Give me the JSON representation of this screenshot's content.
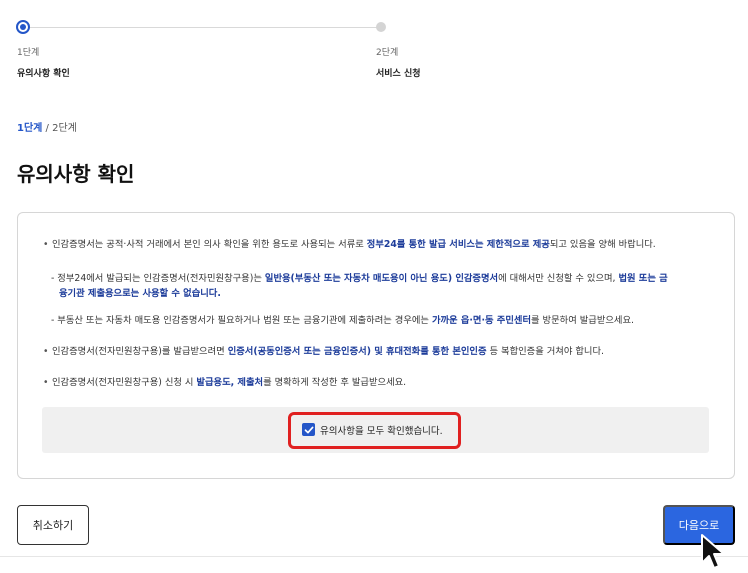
{
  "stepper": {
    "steps": [
      {
        "number": "1단계",
        "name": "유의사항 확인",
        "state": "active"
      },
      {
        "number": "2단계",
        "name": "서비스 신청",
        "state": "pending"
      }
    ]
  },
  "breadcrumb": {
    "current": "1단계",
    "separator": " / ",
    "total": "2단계"
  },
  "page_title": "유의사항 확인",
  "notice": {
    "item1": {
      "pre": "인감증명서는 공적·사적 거래에서 본인 의사 확인을 위한 용도로 사용되는 서류로 ",
      "bold": "정부24를 통한 발급 서비스는 제한적으로 제공",
      "post": "되고 있음을 양해 바랍니다."
    },
    "sub1": {
      "pre": "- 정부24에서 발급되는 인감증명서(전자민원창구용)는 ",
      "bold1": "일반용(부동산 또는 자동차 매도용이 아닌 용도) 인감증명서",
      "mid": "에 대해서만 신청할 수 있으며, ",
      "bold2": "법원 또는 금",
      "line2_bold": "융기관 제출용으로는 사용할 수 없습니다."
    },
    "sub2": {
      "pre": "- 부동산 또는 자동차 매도용 인감증명서가 필요하거나 법원 또는 금융기관에 제출하려는 경우에는 ",
      "bold": "가까운 읍·면·동 주민센터",
      "post": "를 방문하여 발급받으세요."
    },
    "item2": {
      "pre": "인감증명서(전자민원창구용)를 발급받으려면 ",
      "bold": "인증서(공동인증서 또는 금융인증서) 및 휴대전화를 통한 본인인증",
      "post": " 등 복합인증을 거쳐야 합니다."
    },
    "item3": {
      "pre": "인감증명서(전자민원창구용) 신청 시 ",
      "bold": "발급용도, 제출처",
      "post": "를 명확하게 작성한 후 발급받으세요."
    }
  },
  "agree": {
    "label": "유의사항을 모두 확인했습니다.",
    "checked": true
  },
  "buttons": {
    "cancel": "취소하기",
    "next": "다음으로"
  },
  "colors": {
    "accent": "#2456c8",
    "button_primary": "#2b66e0",
    "highlight": "#e02020",
    "emphasis_text": "#1d3c9a"
  },
  "icons": {
    "checkbox": "check-icon",
    "cursor": "mouse-pointer-icon"
  }
}
